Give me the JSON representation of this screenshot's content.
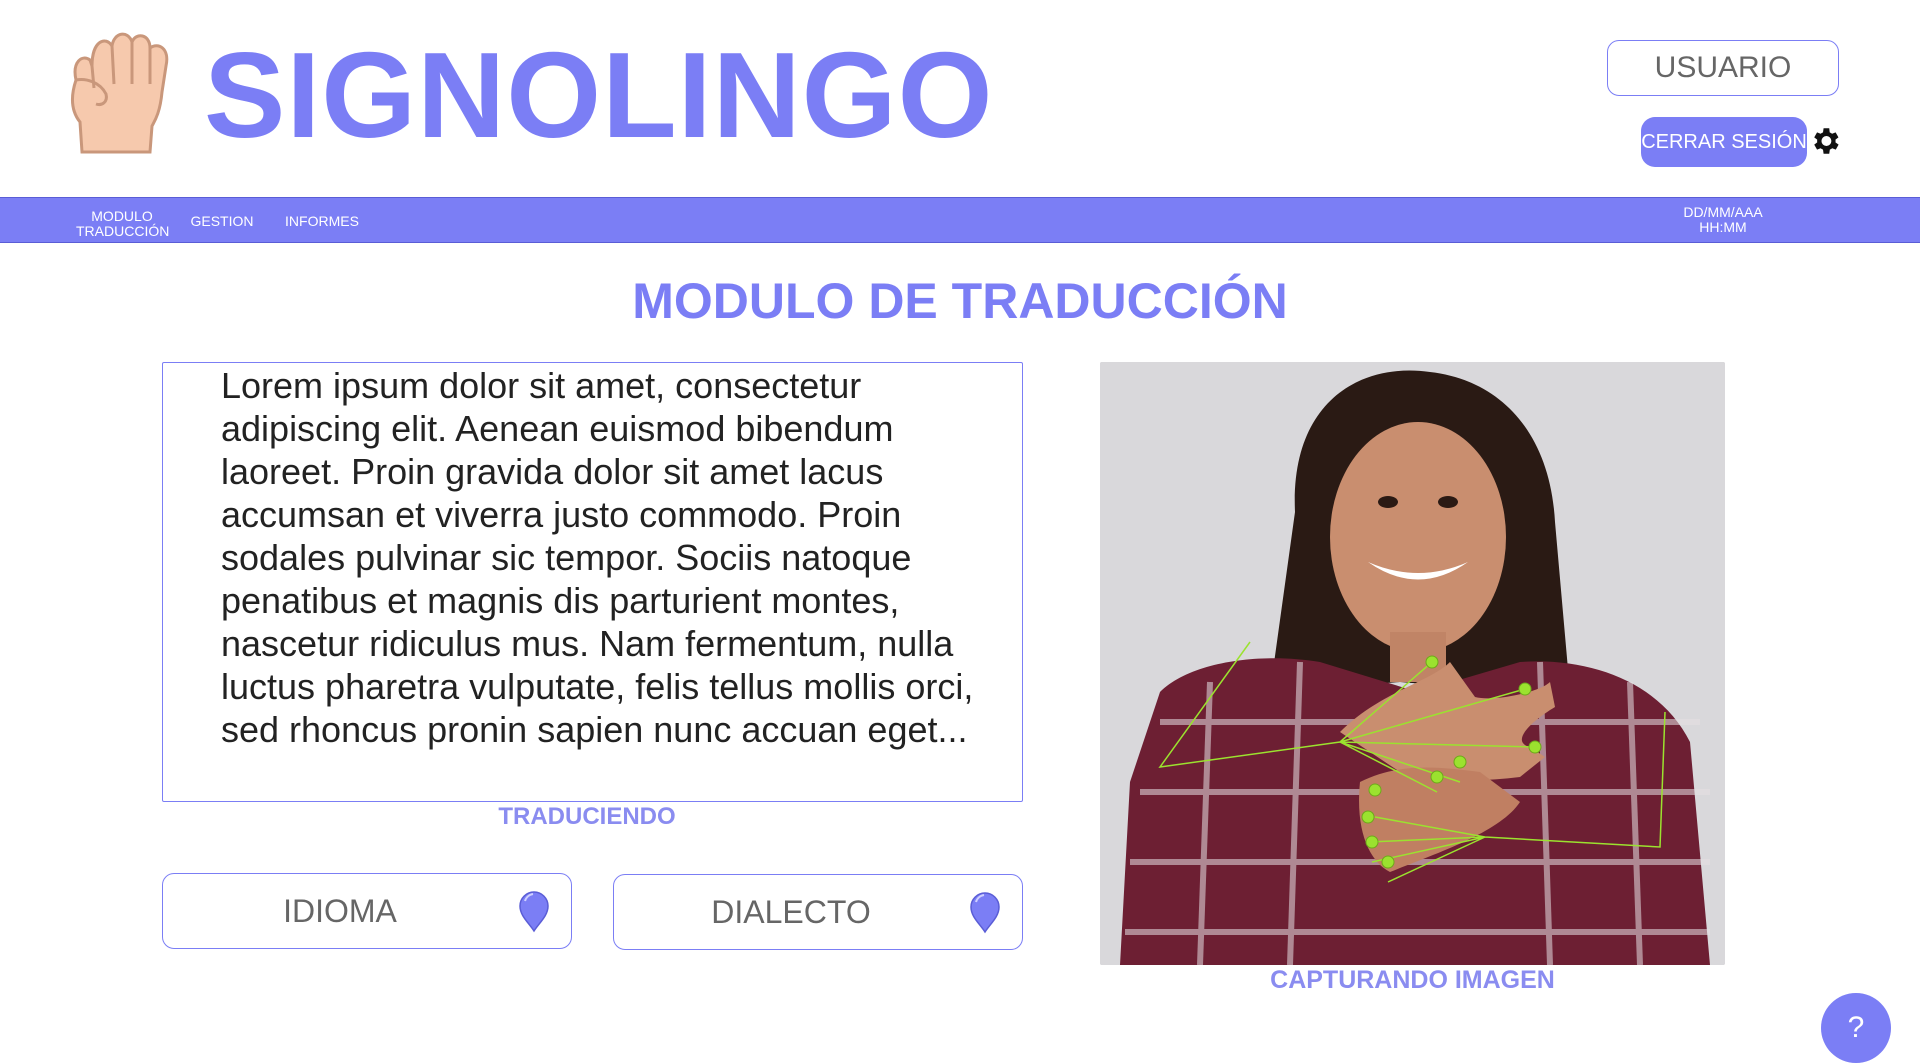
{
  "header": {
    "brand": "SIGNOLINGO",
    "user_label": "USUARIO",
    "logout_label": "CERRAR SESIÓN",
    "icons": [
      "fist-hand-icon",
      "gear-icon"
    ]
  },
  "nav": {
    "items": [
      {
        "label": "MODULO TRADUCCIÓN"
      },
      {
        "label": "GESTION"
      },
      {
        "label": "INFORMES"
      }
    ],
    "date": "DD/MM/AAA",
    "time": "HH:MM"
  },
  "main": {
    "title": "MODULO DE TRADUCCIÓN",
    "translation_text": "Lorem ipsum dolor sit amet, consectetur adipiscing elit. Aenean euismod bibendum laoreet. Proin gravida dolor sit amet lacus accumsan et viverra justo commodo. Proin sodales pulvinar sic tempor. Sociis natoque penatibus et magnis dis parturient montes, nascetur ridiculus mus. Nam fermentum, nulla luctus pharetra vulputate, felis tellus mollis orci, sed rhoncus pronin sapien nunc accuan eget...",
    "translation_status": "TRADUCIENDO",
    "language_select": {
      "value": "IDIOMA"
    },
    "dialect_select": {
      "value": "DIALECTO"
    },
    "camera_status": "CAPTURANDO IMAGEN"
  },
  "help_label": "?",
  "colors": {
    "accent": "#7b7ef5",
    "status": "#8a8cf0",
    "landmark": "#9be22f"
  }
}
